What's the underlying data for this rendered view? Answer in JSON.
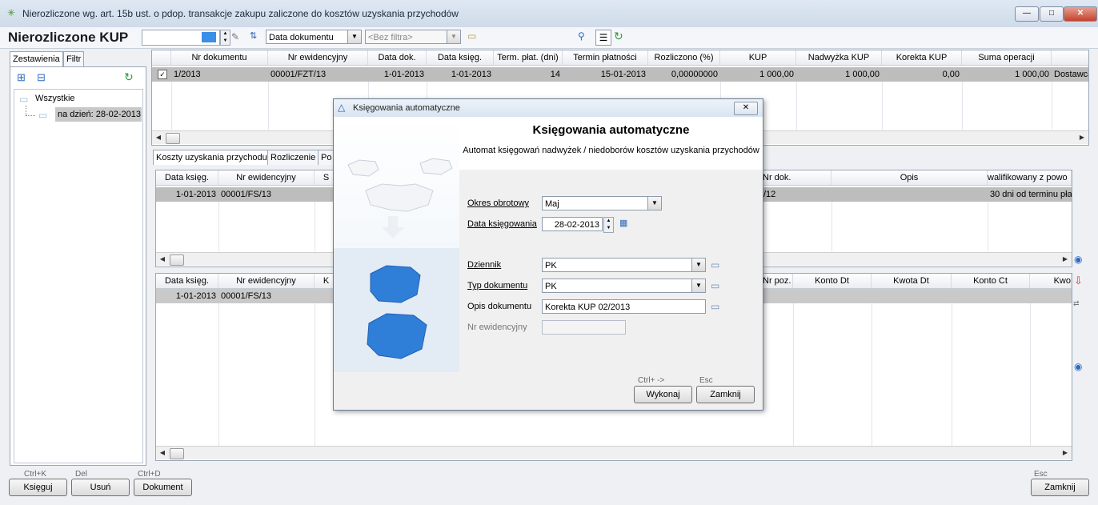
{
  "window": {
    "title": "Nierozliczone wg. art. 15b ust. o pdop. transakcje zakupu zaliczone do kosztów uzyskania przychodów",
    "min_label": "—",
    "max_label": "□",
    "close_label": "✕"
  },
  "toolbar": {
    "heading": "Nierozliczone KUP",
    "sort_value": "Data dokumentu",
    "filter_placeholder": "<Bez filtra>",
    "sort_icon": "sort-az-icon"
  },
  "left": {
    "tabs": [
      "Zestawienia",
      "Filtr"
    ],
    "tree": {
      "root": "Wszystkie",
      "child": "na dzień: 28-02-2013"
    }
  },
  "grid_top": {
    "columns": [
      "Nr dokumentu",
      "Nr ewidencyjny",
      "Data dok.",
      "Data księg.",
      "Term. płat. (dni)",
      "Termin płatności",
      "Rozliczono (%)",
      "KUP",
      "Nadwyżka KUP",
      "Korekta KUP",
      "Suma operacji"
    ],
    "row": {
      "checked": true,
      "cells": [
        "1/2013",
        "00001/FZT/13",
        "1-01-2013",
        "1-01-2013",
        "14",
        "15-01-2013",
        "0,00000000",
        "1 000,00",
        "1 000,00",
        "0,00",
        "1 000,00",
        "Dostawca"
      ]
    }
  },
  "middle": {
    "tabs": [
      "Koszty uzyskania przychodu",
      "Rozliczenie",
      "Po"
    ],
    "columns_left": [
      "Data księg.",
      "Nr ewidencyjny",
      "S"
    ],
    "columns_right": [
      "Nr dok.",
      "Opis",
      "walifikowany z powo"
    ],
    "row_left": [
      "1-01-2013",
      "00001/FS/13"
    ],
    "row_right": [
      "/12",
      "",
      "30 dni od terminu pła"
    ]
  },
  "bottom": {
    "columns_left": [
      "Data księg.",
      "Nr ewidencyjny",
      "K"
    ],
    "columns_right": [
      "Nr poz.",
      "Konto Dt",
      "Kwota Dt",
      "Konto Ct",
      "Kwo"
    ],
    "row_left": [
      "1-01-2013",
      "00001/FS/13"
    ]
  },
  "footer": {
    "buttons": [
      {
        "hint": "Ctrl+K",
        "label": "Księguj"
      },
      {
        "hint": "Del",
        "label": "Usuń"
      },
      {
        "hint": "Ctrl+D",
        "label": "Dokument"
      }
    ],
    "close": {
      "hint": "Esc",
      "label": "Zamknij"
    }
  },
  "dialog": {
    "title": "Księgowania automatyczne",
    "heading": "Księgowania automatyczne",
    "subheading": "Automat księgowań nadwyżek / niedoborów kosztów uzyskania przychodów",
    "fields": {
      "okres_label": "Okres obrotowy",
      "okres_value": "Maj",
      "data_label": "Data księgowania",
      "data_value": "28-02-2013",
      "dziennik_label": "Dziennik",
      "dziennik_value": "PK",
      "typ_label": "Typ dokumentu",
      "typ_value": "PK",
      "opis_label": "Opis dokumentu",
      "opis_value": "Korekta KUP 02/2013",
      "nrew_label": "Nr ewidencyjny",
      "nrew_value": ""
    },
    "buttons": {
      "run_hint": "Ctrl+ ->",
      "run_label": "Wykonaj",
      "close_hint": "Esc",
      "close_label": "Zamknij"
    }
  },
  "colors": {
    "selection_row": "#bdbdbd",
    "accent_blue": "#2f7fd8",
    "refresh_green": "#2e9a3a"
  }
}
